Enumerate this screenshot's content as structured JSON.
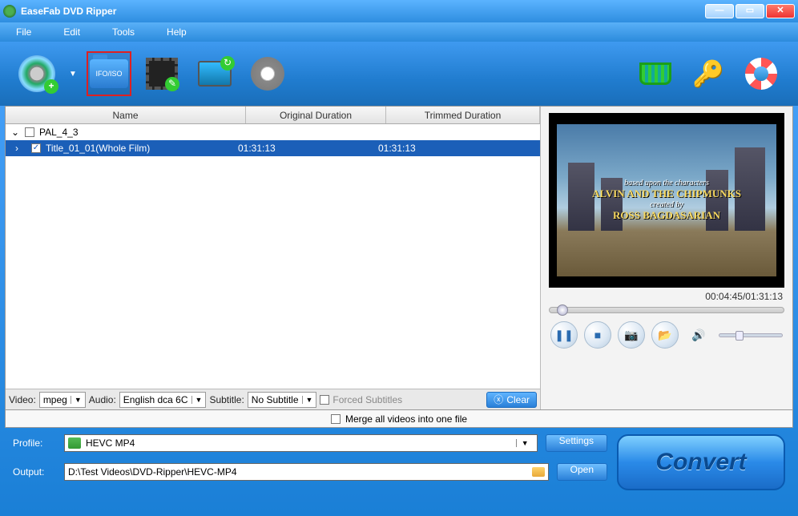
{
  "app": {
    "title": "EaseFab DVD Ripper"
  },
  "menu": {
    "file": "File",
    "edit": "Edit",
    "tools": "Tools",
    "help": "Help"
  },
  "toolbar": {
    "ifo_label": "IFO/ISO"
  },
  "columns": {
    "name": "Name",
    "original": "Original Duration",
    "trimmed": "Trimmed Duration"
  },
  "list": {
    "group": "PAL_4_3",
    "item": {
      "name": "Title_01_01(Whole Film)",
      "original": "01:31:13",
      "trimmed": "01:31:13"
    }
  },
  "streams": {
    "video_label": "Video:",
    "video_value": "mpeg",
    "audio_label": "Audio:",
    "audio_value": "English dca 6C",
    "subtitle_label": "Subtitle:",
    "subtitle_value": "No Subtitle",
    "forced_label": "Forced Subtitles",
    "clear": "Clear"
  },
  "preview": {
    "caption1": "based upon the characters",
    "caption2": "ALVIN AND THE CHIPMUNKS",
    "caption3": "created by",
    "caption4": "ROSS BAGDASARIAN",
    "time": "00:04:45/01:31:13"
  },
  "merge": {
    "label": "Merge all videos into one file"
  },
  "profile": {
    "label": "Profile:",
    "value": "HEVC MP4",
    "settings": "Settings"
  },
  "output": {
    "label": "Output:",
    "value": "D:\\Test Videos\\DVD-Ripper\\HEVC-MP4",
    "open": "Open"
  },
  "convert": {
    "label": "Convert"
  }
}
